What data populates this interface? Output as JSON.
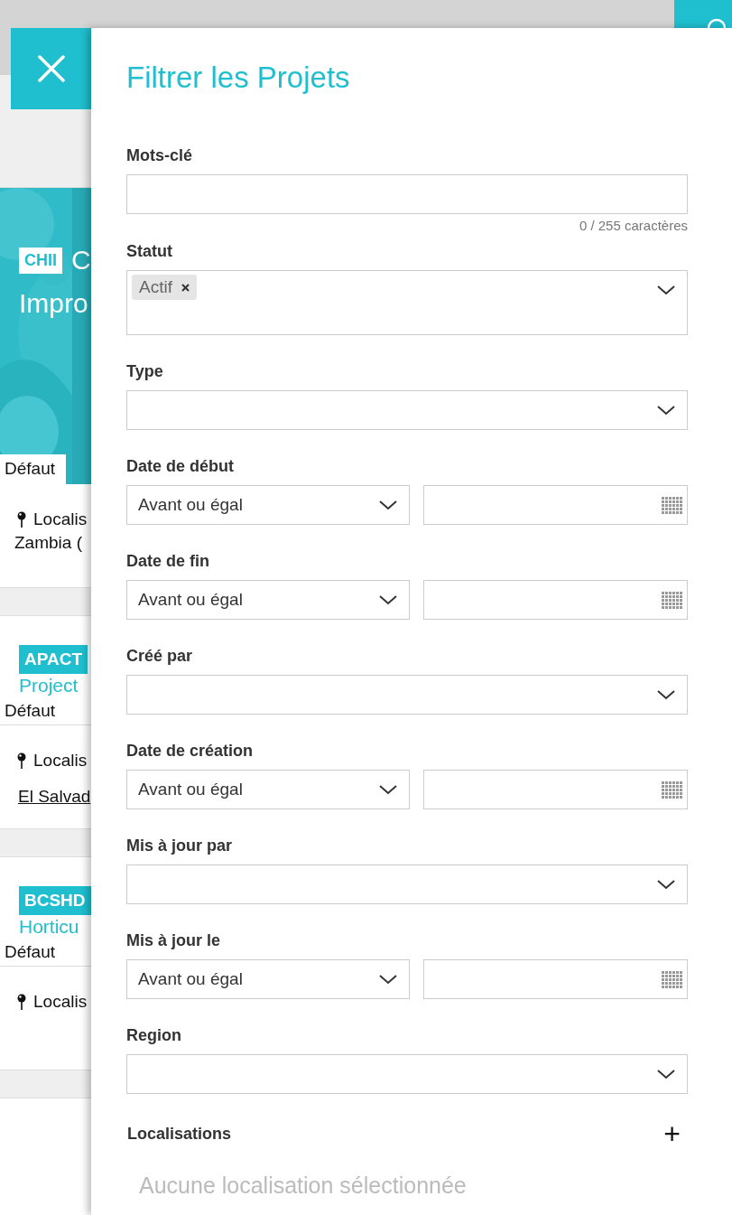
{
  "background_page": {
    "cards": [
      {
        "kind": "feature",
        "tag": "CHII",
        "title_lines": [
          "C",
          "Impro"
        ],
        "tab": "Défaut",
        "location_label": "Localis",
        "location_value": "Zambia ("
      },
      {
        "kind": "linked",
        "tag": "APACT",
        "title_lines": [
          "Project"
        ],
        "tab": "Défaut",
        "location_label": "Localis",
        "location_value": "El Salvad"
      },
      {
        "kind": "plain",
        "tag": "BCSHD",
        "title_lines": [
          "Horticu"
        ],
        "tab": "Défaut",
        "location_label": "Localis"
      }
    ]
  },
  "panel": {
    "title": "Filtrer les Projets",
    "filters": [
      {
        "kind": "text",
        "label": "Mots-clé",
        "counter": "0 / 255 caractères"
      },
      {
        "kind": "multiselect",
        "label": "Statut",
        "chips": [
          "Actif"
        ]
      },
      {
        "kind": "select",
        "label": "Type"
      },
      {
        "kind": "date",
        "label": "Date de début",
        "operator": "Avant ou égal"
      },
      {
        "kind": "date",
        "label": "Date de fin",
        "operator": "Avant ou égal"
      },
      {
        "kind": "select",
        "label": "Créé par"
      },
      {
        "kind": "date",
        "label": "Date de création",
        "operator": "Avant ou égal"
      },
      {
        "kind": "select",
        "label": "Mis à jour par"
      },
      {
        "kind": "date",
        "label": "Mis à jour le",
        "operator": "Avant ou égal"
      },
      {
        "kind": "select",
        "label": "Region"
      }
    ],
    "locations": {
      "label": "Localisations",
      "add_symbol": "+",
      "empty_text": "Aucune localisation sélectionnée"
    }
  }
}
